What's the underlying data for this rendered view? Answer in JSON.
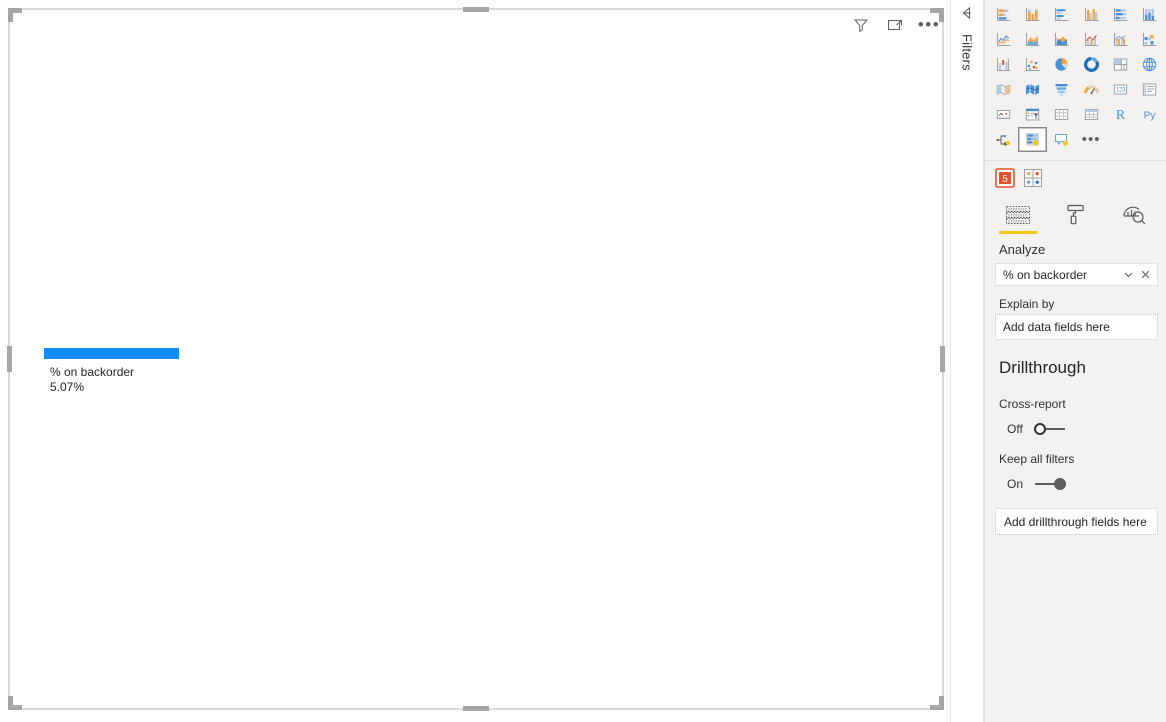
{
  "canvas": {
    "visual": {
      "type": "key-influencers",
      "header_icons": [
        {
          "name": "filter-icon",
          "label": "Filters"
        },
        {
          "name": "focus-mode-icon",
          "label": "Focus mode"
        },
        {
          "name": "more-options-icon",
          "label": "More options"
        }
      ],
      "bar_label": "% on backorder",
      "bar_value": "5.07%",
      "bar_color": "#118DFF"
    }
  },
  "filters_pane": {
    "label": "Filters",
    "expand_icon": "expand-filters-icon"
  },
  "viz_pane": {
    "gallery": [
      {
        "name": "stacked-bar-chart-icon",
        "label": "Stacked bar chart",
        "selected": false
      },
      {
        "name": "stacked-column-chart-icon",
        "label": "Stacked column chart",
        "selected": false
      },
      {
        "name": "clustered-bar-chart-icon",
        "label": "Clustered bar chart",
        "selected": false
      },
      {
        "name": "clustered-column-chart-icon",
        "label": "Clustered column chart",
        "selected": false
      },
      {
        "name": "hundred-percent-stacked-bar-chart-icon",
        "label": "100% stacked bar chart",
        "selected": false
      },
      {
        "name": "hundred-percent-stacked-column-chart-icon",
        "label": "100% stacked column chart",
        "selected": false
      },
      {
        "name": "line-chart-icon",
        "label": "Line chart",
        "selected": false
      },
      {
        "name": "area-chart-icon",
        "label": "Area chart",
        "selected": false
      },
      {
        "name": "stacked-area-chart-icon",
        "label": "Stacked area chart",
        "selected": false
      },
      {
        "name": "line-and-stacked-column-chart-icon",
        "label": "Line and stacked column chart",
        "selected": false
      },
      {
        "name": "line-and-clustered-column-chart-icon",
        "label": "Line and clustered column chart",
        "selected": false
      },
      {
        "name": "ribbon-chart-icon",
        "label": "Ribbon chart",
        "selected": false
      },
      {
        "name": "waterfall-chart-icon",
        "label": "Waterfall chart",
        "selected": false
      },
      {
        "name": "scatter-chart-icon",
        "label": "Scatter chart",
        "selected": false
      },
      {
        "name": "pie-chart-icon",
        "label": "Pie chart",
        "selected": false
      },
      {
        "name": "donut-chart-icon",
        "label": "Donut chart",
        "selected": false
      },
      {
        "name": "treemap-icon",
        "label": "Treemap",
        "selected": false
      },
      {
        "name": "map-icon",
        "label": "Map",
        "selected": false
      },
      {
        "name": "filled-map-icon",
        "label": "Filled map",
        "selected": false
      },
      {
        "name": "shape-map-icon",
        "label": "Shape map",
        "selected": false
      },
      {
        "name": "funnel-icon",
        "label": "Funnel",
        "selected": false
      },
      {
        "name": "gauge-icon",
        "label": "Gauge",
        "selected": false
      },
      {
        "name": "card-icon",
        "label": "Card",
        "selected": false
      },
      {
        "name": "multi-row-card-icon",
        "label": "Multi-row card",
        "selected": false
      },
      {
        "name": "kpi-icon",
        "label": "KPI",
        "selected": false
      },
      {
        "name": "slicer-icon",
        "label": "Slicer",
        "selected": false
      },
      {
        "name": "table-icon",
        "label": "Table",
        "selected": false
      },
      {
        "name": "matrix-icon",
        "label": "Matrix",
        "selected": false
      },
      {
        "name": "r-script-visual-icon",
        "label": "R",
        "selected": false
      },
      {
        "name": "python-visual-icon",
        "label": "Py",
        "selected": false
      },
      {
        "name": "decomposition-tree-icon",
        "label": "Decomposition tree",
        "selected": false
      },
      {
        "name": "key-influencers-icon",
        "label": "Key influencers",
        "selected": true
      },
      {
        "name": "smart-narrative-icon",
        "label": "Smart narrative",
        "selected": false
      },
      {
        "name": "more-visuals-icon",
        "label": "More options",
        "selected": false
      }
    ],
    "custom_visuals": [
      {
        "name": "html-content-custom-visual-icon",
        "label": "HTML Content"
      },
      {
        "name": "get-more-visuals-icon",
        "label": "Get more visuals"
      }
    ],
    "tabs": [
      {
        "name": "tab-fields",
        "label": "Fields",
        "icon": "fields-icon",
        "active": true
      },
      {
        "name": "tab-format",
        "label": "Format",
        "icon": "paint-roller-icon",
        "active": false
      },
      {
        "name": "tab-analytics",
        "label": "Analytics",
        "icon": "analytics-magnifier-icon",
        "active": false
      }
    ],
    "analyze": {
      "section_label": "Analyze",
      "field_value": "% on backorder",
      "dropdown_icon": "chevron-down-icon",
      "remove_icon": "close-icon",
      "explain_by_label": "Explain by",
      "explain_by_placeholder": "Add data fields here"
    },
    "drillthrough": {
      "title": "Drillthrough",
      "cross_report_label": "Cross-report",
      "cross_report_state": "Off",
      "keep_all_filters_label": "Keep all filters",
      "keep_all_filters_state": "On",
      "fields_placeholder": "Add drillthrough fields here"
    }
  },
  "colors": {
    "accent_yellow": "#f2c811",
    "bar_blue": "#118DFF",
    "pane_bg": "#f3f2f1"
  }
}
